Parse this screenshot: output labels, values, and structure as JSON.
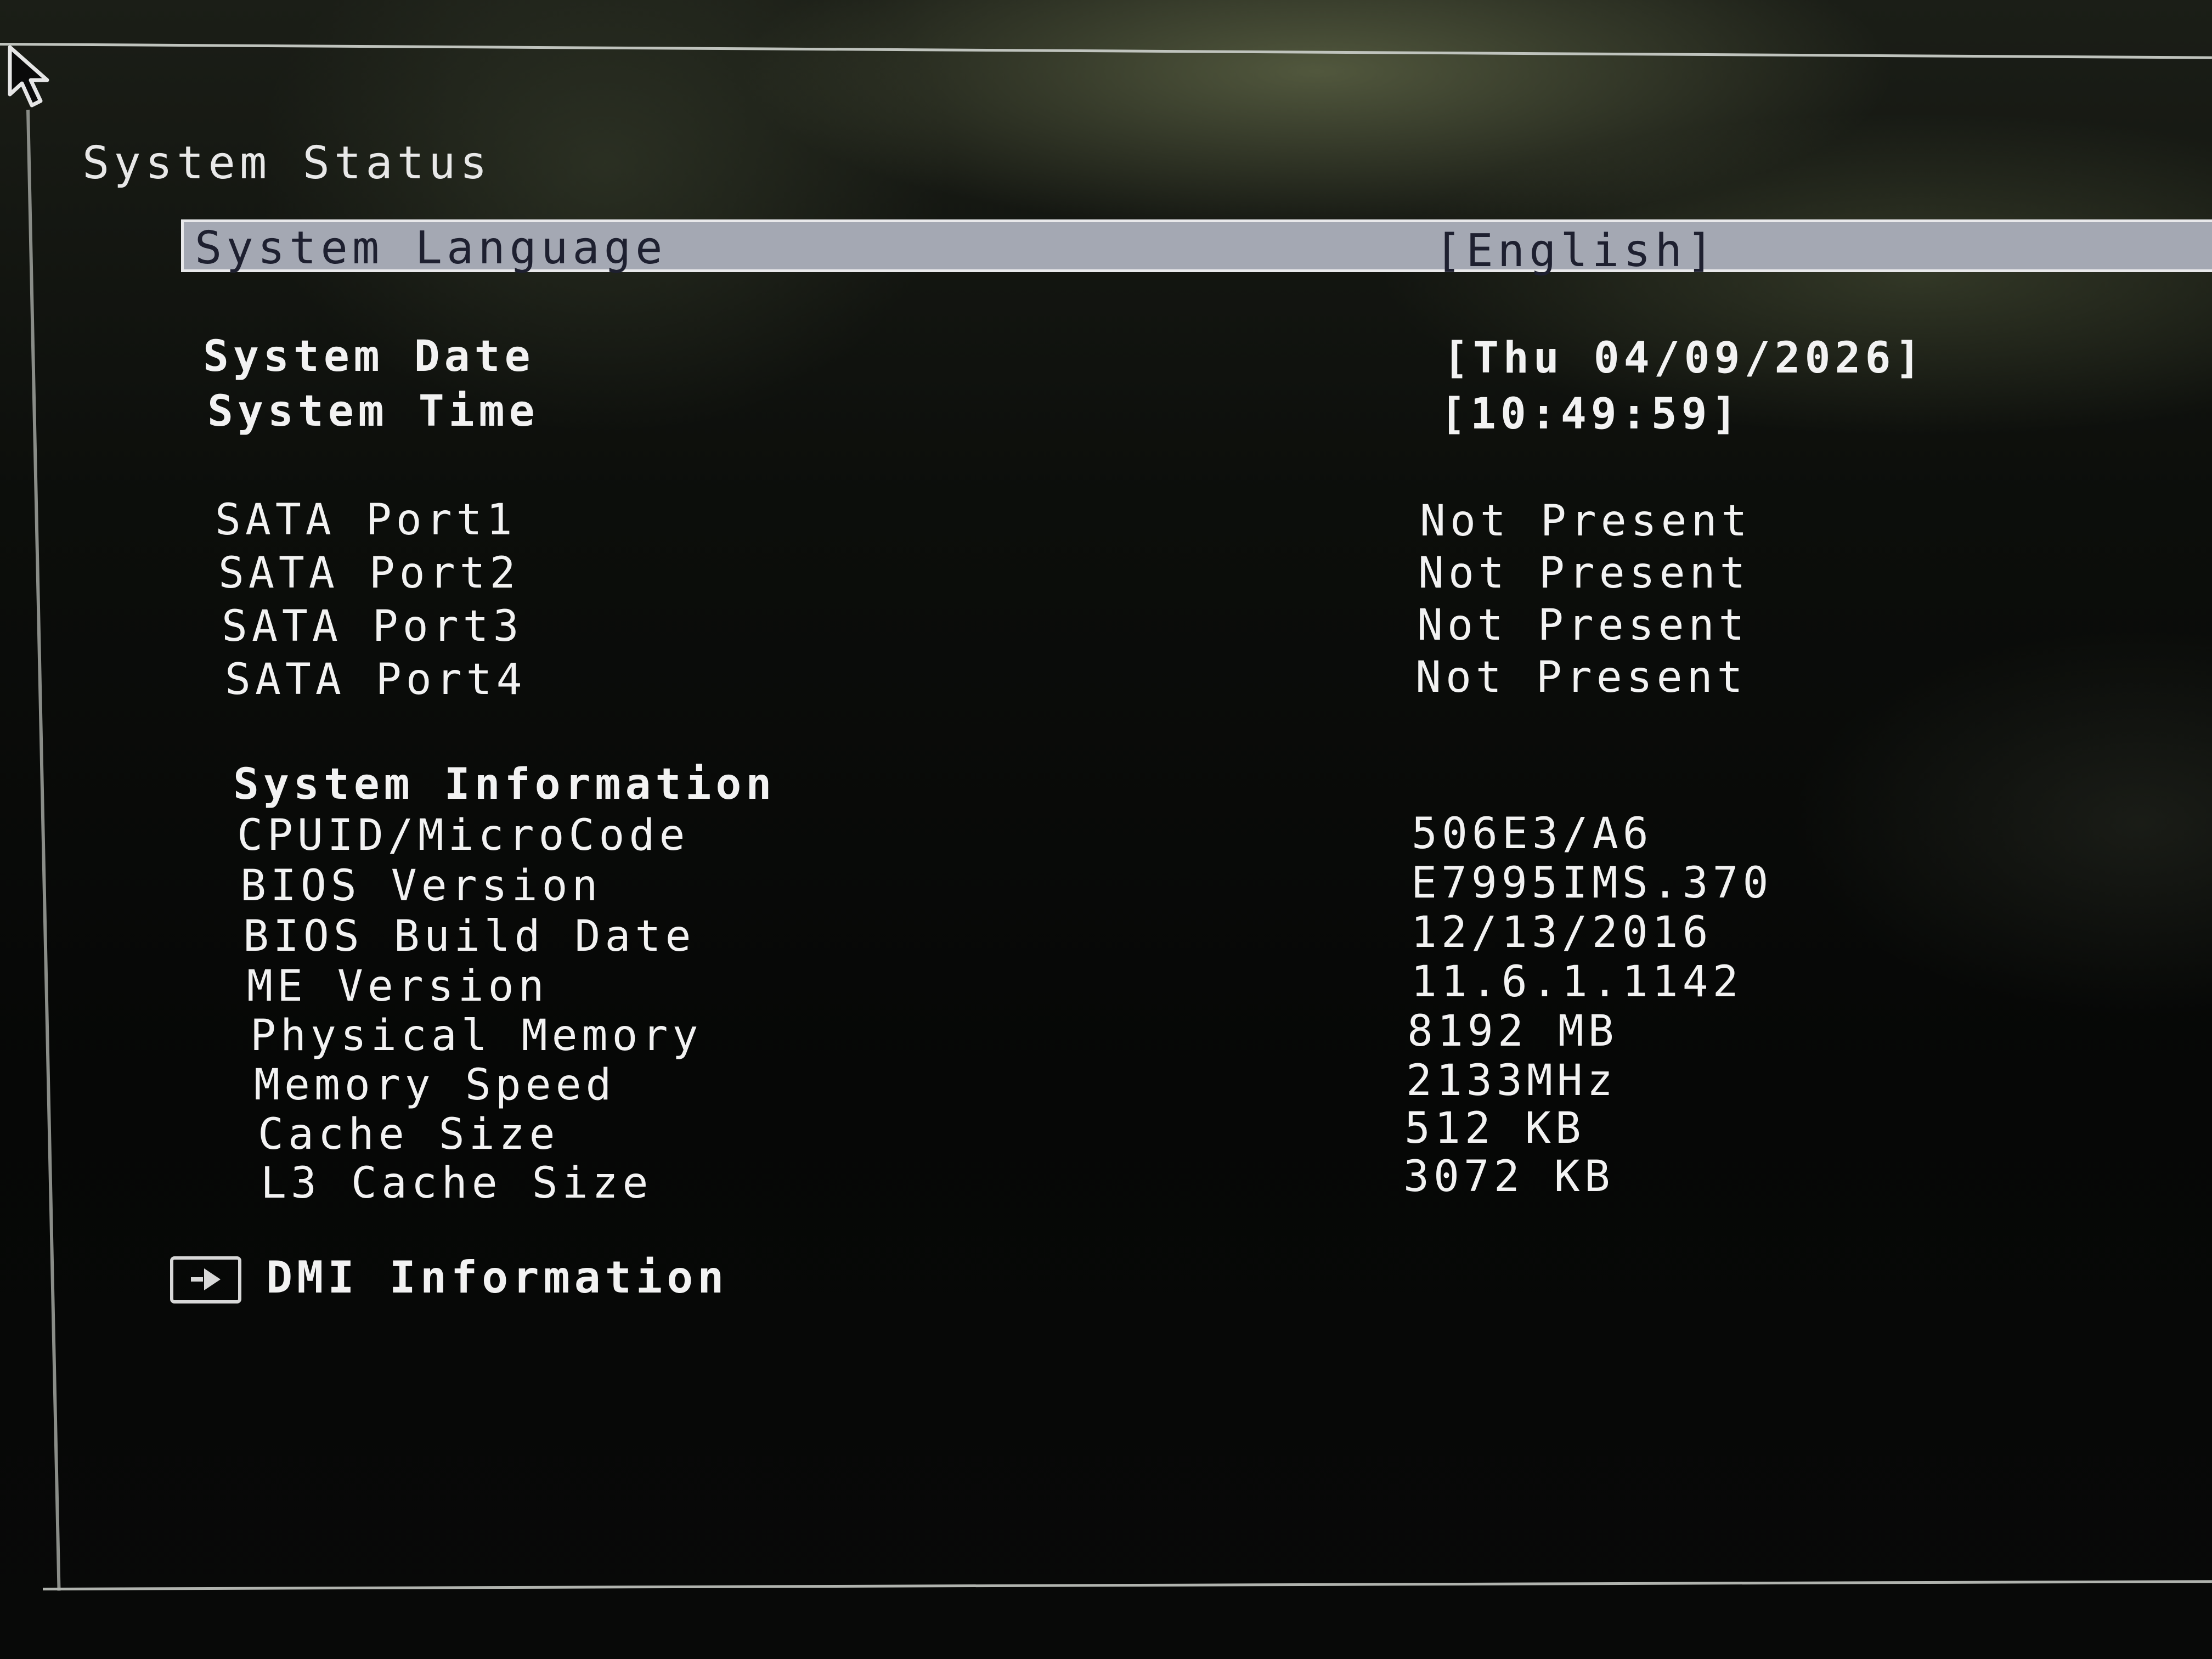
{
  "page": {
    "title": "System Status"
  },
  "language": {
    "label": "System Language",
    "value": "[English]"
  },
  "datetime": {
    "date_label": "System Date",
    "date_value": "[Thu 04/09/2026]",
    "time_label": "System Time",
    "time_value": "[10:49:59]"
  },
  "sata_ports": [
    {
      "label": "SATA Port1",
      "value": "Not Present"
    },
    {
      "label": "SATA Port2",
      "value": "Not Present"
    },
    {
      "label": "SATA Port3",
      "value": "Not Present"
    },
    {
      "label": "SATA Port4",
      "value": "Not Present"
    }
  ],
  "system_info": {
    "heading": "System Information",
    "items": [
      {
        "label": "CPUID/MicroCode",
        "value": "506E3/A6"
      },
      {
        "label": "BIOS Version",
        "value": "E7995IMS.370"
      },
      {
        "label": "BIOS Build Date",
        "value": "12/13/2016"
      },
      {
        "label": "ME Version",
        "value": "11.6.1.1142"
      },
      {
        "label": "Physical Memory",
        "value": "8192 MB"
      },
      {
        "label": "Memory Speed",
        "value": "2133MHz"
      },
      {
        "label": "Cache Size",
        "value": "512 KB"
      },
      {
        "label": "L3 Cache Size",
        "value": "3072 KB"
      }
    ]
  },
  "dmi": {
    "label": "DMI Information",
    "icon": "submenu-arrow-icon"
  },
  "colors": {
    "highlight_bar": "#a4a8b3",
    "highlight_text": "#1e2030",
    "text": "#f2f2f2",
    "background": "#060706"
  }
}
